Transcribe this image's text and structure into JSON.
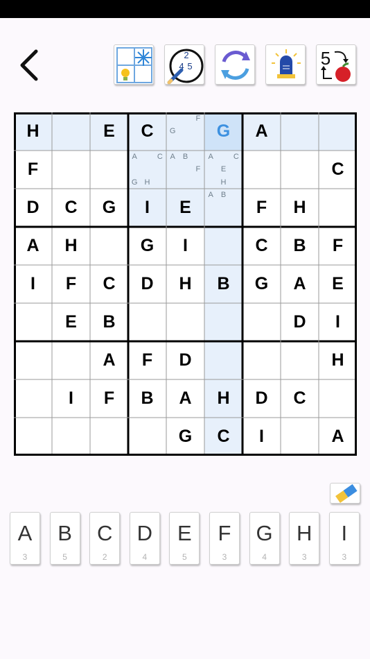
{
  "toolbar": {
    "tools": [
      {
        "name": "hint-tool-button",
        "icon": "lightbulb-sparkle-icon"
      },
      {
        "name": "notes-tool-button",
        "icon": "pencil-notes-icon",
        "digits": [
          "2",
          "4",
          "5"
        ]
      },
      {
        "name": "restart-tool-button",
        "icon": "refresh-icon"
      },
      {
        "name": "alarm-tool-button",
        "icon": "alarm-light-icon"
      },
      {
        "name": "counter-tool-button",
        "icon": "five-apple-icon",
        "digit": "5"
      }
    ]
  },
  "colors": {
    "highlight": "#e7f0fb",
    "selected": "#cfe3f8",
    "selected_value": "#3d91e0",
    "note_text": "#6f7f8c"
  },
  "board": {
    "size": 9,
    "cells": [
      [
        "H",
        "",
        "E",
        "C",
        "",
        "G",
        "A",
        "",
        ""
      ],
      [
        "F",
        "",
        "",
        "",
        "",
        "",
        "",
        "",
        "C"
      ],
      [
        "D",
        "C",
        "G",
        "I",
        "E",
        "",
        "F",
        "H",
        ""
      ],
      [
        "A",
        "H",
        "",
        "G",
        "I",
        "",
        "C",
        "B",
        "F"
      ],
      [
        "I",
        "F",
        "C",
        "D",
        "H",
        "B",
        "G",
        "A",
        "E"
      ],
      [
        "",
        "E",
        "B",
        "",
        "",
        "",
        "",
        "D",
        "I"
      ],
      [
        "",
        "",
        "A",
        "F",
        "D",
        "",
        "",
        "",
        "H"
      ],
      [
        "",
        "I",
        "F",
        "B",
        "A",
        "H",
        "D",
        "C",
        ""
      ],
      [
        "",
        "",
        "",
        "",
        "G",
        "C",
        "I",
        "",
        "A"
      ]
    ],
    "selected": {
      "row": 0,
      "col": 5
    },
    "highlighted": [
      [
        0,
        0
      ],
      [
        0,
        1
      ],
      [
        0,
        2
      ],
      [
        0,
        3
      ],
      [
        0,
        4
      ],
      [
        0,
        6
      ],
      [
        0,
        7
      ],
      [
        0,
        8
      ],
      [
        1,
        3
      ],
      [
        1,
        4
      ],
      [
        1,
        5
      ],
      [
        2,
        3
      ],
      [
        2,
        4
      ],
      [
        2,
        5
      ],
      [
        3,
        5
      ],
      [
        4,
        5
      ],
      [
        5,
        5
      ],
      [
        6,
        5
      ],
      [
        7,
        5
      ],
      [
        8,
        5
      ]
    ],
    "notes": [
      {
        "row": 0,
        "col": 4,
        "marks": [
          "",
          "",
          "F",
          "G",
          "",
          "",
          "",
          "",
          ""
        ]
      },
      {
        "row": 1,
        "col": 3,
        "marks": [
          "A",
          "",
          "C",
          "",
          "",
          "",
          "G",
          "H",
          ""
        ]
      },
      {
        "row": 1,
        "col": 4,
        "marks": [
          "A",
          "B",
          "",
          "",
          "",
          "F",
          "",
          "",
          ""
        ]
      },
      {
        "row": 1,
        "col": 5,
        "marks": [
          "A",
          "",
          "C",
          "",
          "E",
          "",
          "",
          "H",
          ""
        ]
      },
      {
        "row": 2,
        "col": 5,
        "marks": [
          "A",
          "B",
          "",
          "",
          "",
          "",
          "",
          "",
          ""
        ]
      }
    ]
  },
  "keypad": {
    "keys": [
      {
        "letter": "A",
        "count": "3"
      },
      {
        "letter": "B",
        "count": "5"
      },
      {
        "letter": "C",
        "count": "2"
      },
      {
        "letter": "D",
        "count": "4"
      },
      {
        "letter": "E",
        "count": "5"
      },
      {
        "letter": "F",
        "count": "3"
      },
      {
        "letter": "G",
        "count": "4"
      },
      {
        "letter": "H",
        "count": "3"
      },
      {
        "letter": "I",
        "count": "3"
      }
    ]
  },
  "eraser": {
    "icon": "eraser-icon"
  }
}
